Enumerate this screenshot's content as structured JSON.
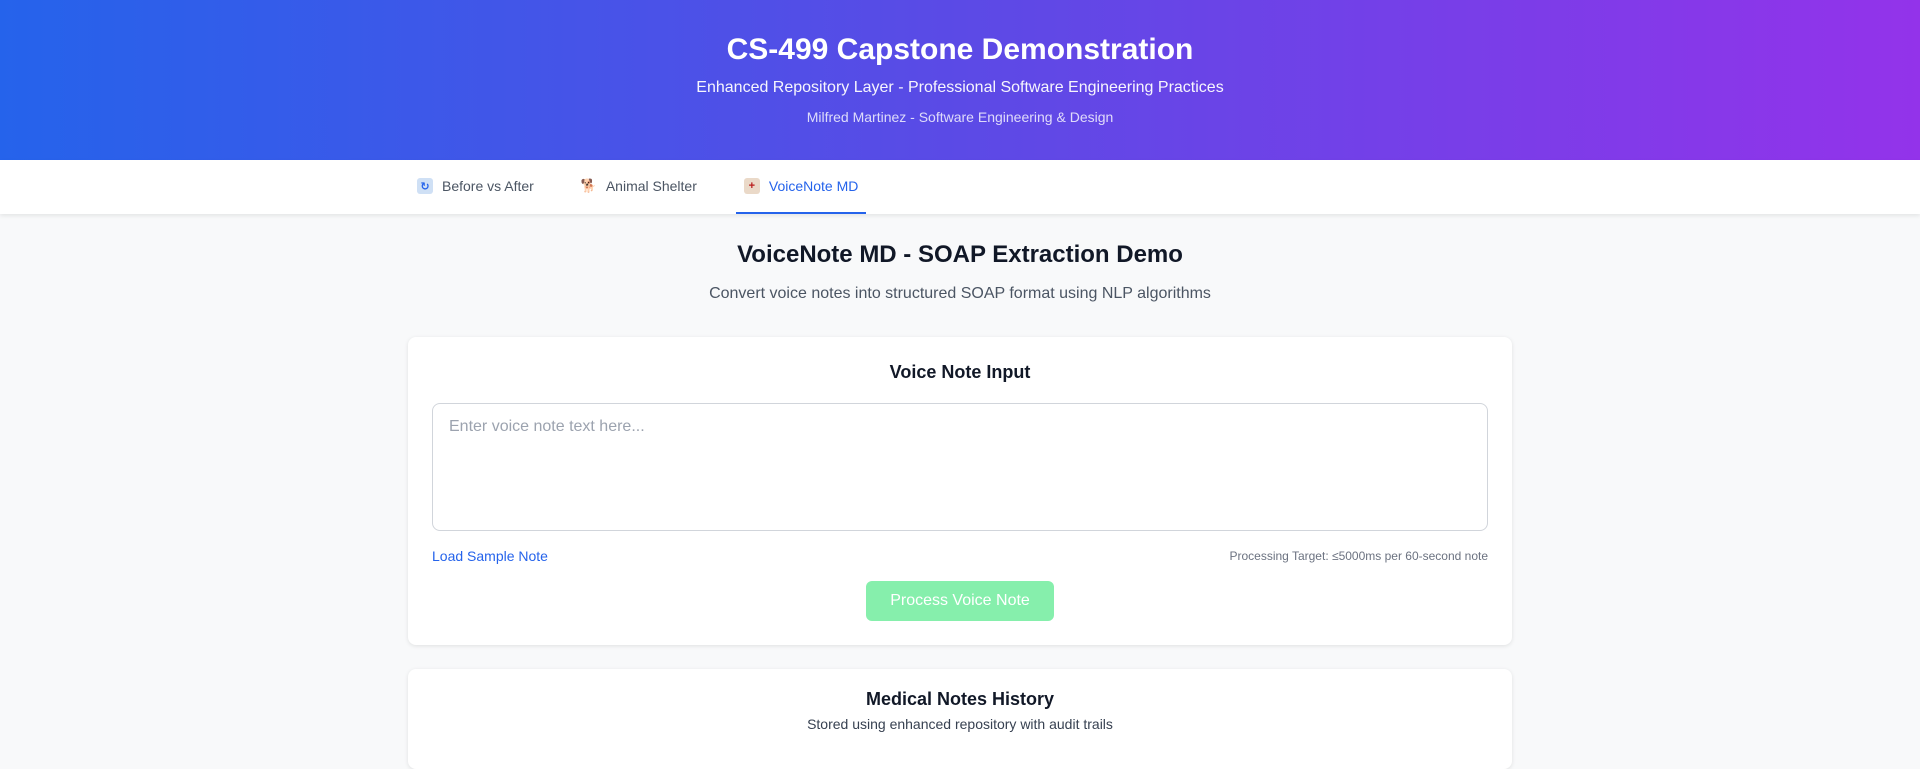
{
  "header": {
    "title": "CS-499 Capstone Demonstration",
    "subtitle": "Enhanced Repository Layer - Professional Software Engineering Practices",
    "author": "Milfred Martinez - Software Engineering & Design"
  },
  "nav": {
    "tabs": [
      {
        "label": "Before vs After",
        "icon": "refresh-icon",
        "active": false
      },
      {
        "label": "Animal Shelter",
        "icon": "dog-icon",
        "active": false
      },
      {
        "label": "VoiceNote MD",
        "icon": "hospital-icon",
        "active": true
      }
    ]
  },
  "main": {
    "title": "VoiceNote MD - SOAP Extraction Demo",
    "description": "Convert voice notes into structured SOAP format using NLP algorithms"
  },
  "input_card": {
    "title": "Voice Note Input",
    "textarea_value": "",
    "textarea_placeholder": "Enter voice note text here...",
    "load_sample_label": "Load Sample Note",
    "processing_target": "Processing Target: ≤5000ms per 60-second note",
    "process_button_label": "Process Voice Note",
    "process_button_disabled": true
  },
  "history_card": {
    "title": "Medical Notes History",
    "description": "Stored using enhanced repository with audit trails"
  },
  "colors": {
    "gradient_start": "#2563eb",
    "gradient_end": "#9333ea",
    "accent": "#2563eb",
    "button_disabled": "#86efac"
  }
}
